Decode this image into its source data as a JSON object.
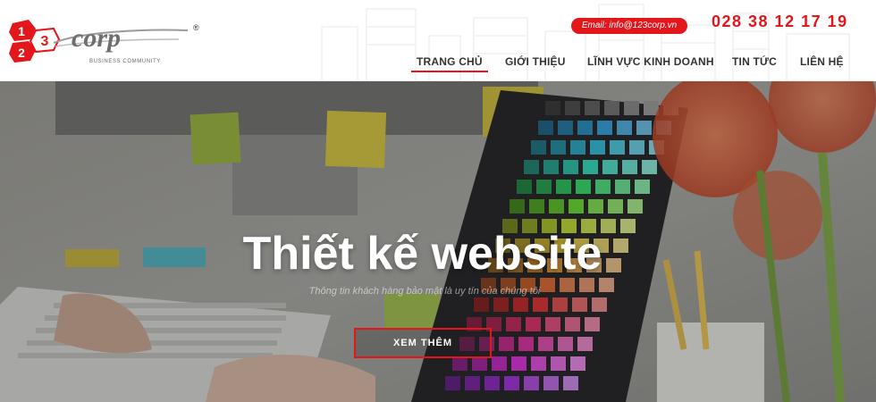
{
  "header": {
    "logo": {
      "digits": [
        "1",
        "2",
        "3"
      ],
      "wordmark": "corp",
      "registered": "®",
      "tagline": "BUSINESS COMMUNITY"
    },
    "email_label": "Email: info@123corp.vn",
    "phone": "028 38 12 17 19"
  },
  "nav": {
    "items": [
      {
        "label": "TRANG CHỦ",
        "active": true
      },
      {
        "label": "GIỚI THIỆU",
        "active": false
      },
      {
        "label": "LĨNH VỰC KINH DOANH",
        "active": false
      },
      {
        "label": "TIN TỨC",
        "active": false
      },
      {
        "label": "LIÊN HỆ",
        "active": false
      }
    ]
  },
  "hero": {
    "title": "Thiết kế website",
    "subtitle": "Thông tin khách hàng bảo mật là uy tín của chúng tôi",
    "button_label": "XEM THÊM"
  },
  "colors": {
    "accent": "#e3161b",
    "nav_text": "#333333",
    "hero_text": "#ffffff"
  }
}
